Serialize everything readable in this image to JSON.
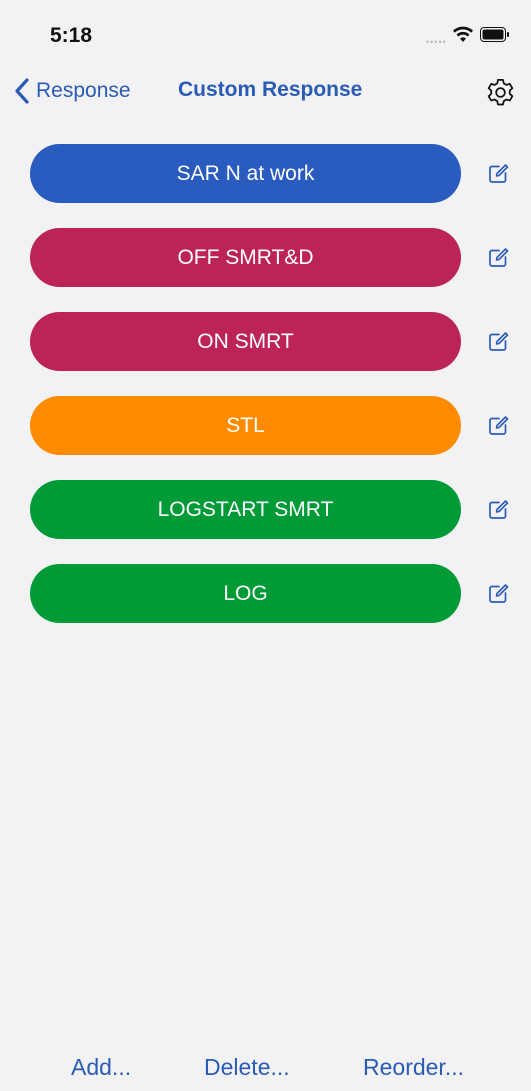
{
  "status_bar": {
    "time": "5:18",
    "signal_dots": "•••••"
  },
  "nav": {
    "back_label": "Response",
    "title": "Custom Response",
    "accent_color": "#2a5bb5"
  },
  "responses": [
    {
      "label": "SAR N at work",
      "color": "#2a5bbf"
    },
    {
      "label": "OFF SMRT&D",
      "color": "#bc2457"
    },
    {
      "label": "ON SMRT",
      "color": "#bc2457"
    },
    {
      "label": "STL",
      "color": "#ff8b00"
    },
    {
      "label": "LOGSTART SMRT",
      "color": "#009a37"
    },
    {
      "label": "LOG",
      "color": "#009a37"
    }
  ],
  "toolbar": {
    "add_label": "Add...",
    "delete_label": "Delete...",
    "reorder_label": "Reorder..."
  },
  "icons": {
    "back": "chevron-left-icon",
    "settings": "gear-icon",
    "edit": "edit-square-icon",
    "wifi": "wifi-icon",
    "battery": "battery-icon"
  }
}
